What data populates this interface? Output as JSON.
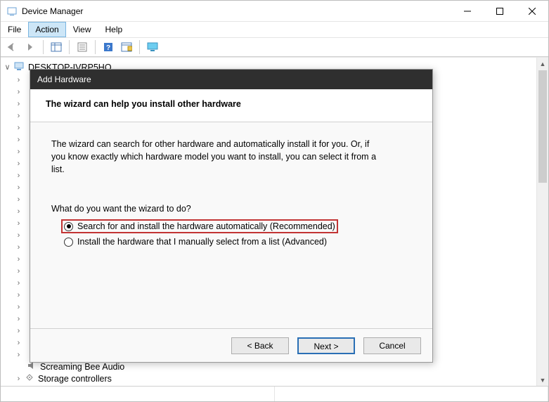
{
  "window": {
    "title": "Device Manager"
  },
  "menu": {
    "file": "File",
    "action": "Action",
    "view": "View",
    "help": "Help"
  },
  "tree": {
    "root": "DESKTOP-IVRP5HO",
    "last_visible": {
      "label1": "Screaming Bee Audio",
      "label2": "Storage controllers"
    }
  },
  "dialog": {
    "title": "Add Hardware",
    "header": "The wizard can help you install other hardware",
    "description": "The wizard can search for other hardware and automatically install it for you. Or, if you know exactly which hardware model you want to install, you can select it from a list.",
    "prompt": "What do you want the wizard to do?",
    "option1": "Search for and install the hardware automatically (Recommended)",
    "option2": "Install the hardware that I manually select from a list (Advanced)",
    "buttons": {
      "back": "< Back",
      "next": "Next >",
      "cancel": "Cancel"
    }
  }
}
